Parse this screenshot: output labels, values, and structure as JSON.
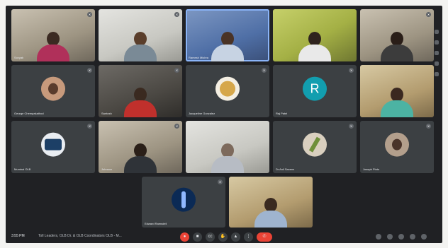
{
  "meeting": {
    "time": "3:55 PM",
    "title": "Toll Leaders, OLB Dr. & OLB Coordinators OLB - M..."
  },
  "participants": [
    {
      "name": "Sovyab",
      "muted": true
    },
    {
      "name": "",
      "muted": true
    },
    {
      "name": "Ramesh Mishra",
      "muted": false
    },
    {
      "name": "",
      "muted": false
    },
    {
      "name": "",
      "muted": true
    },
    {
      "name": "George Chempakathod",
      "muted": true
    },
    {
      "name": "Santosh",
      "muted": true
    },
    {
      "name": "Jacqueline Gonzalez",
      "muted": true
    },
    {
      "name": "Raj Patel",
      "muted": true
    },
    {
      "name": "",
      "muted": false
    },
    {
      "name": "Mumbai OLB",
      "muted": true
    },
    {
      "name": "Johnson",
      "muted": true
    },
    {
      "name": "",
      "muted": false
    },
    {
      "name": "Dr.Anil Saxena",
      "muted": true
    },
    {
      "name": "Joseph Pinto",
      "muted": true
    },
    {
      "name": "Edward Ramsdell",
      "muted": true
    },
    {
      "name": "",
      "muted": false
    }
  ],
  "avatar_letters": {
    "raj": "R"
  },
  "icons": {
    "mic": "mic-off-icon",
    "cam": "camera-icon",
    "cc": "captions-icon",
    "hand": "raise-hand-icon",
    "present": "present-icon",
    "more": "more-options-icon",
    "end": "end-call-icon",
    "info": "info-icon",
    "people": "people-icon",
    "chat": "chat-icon",
    "activities": "activities-icon",
    "lock": "host-controls-icon"
  },
  "labels": {
    "mic": "●",
    "cam": "■",
    "cc": "cc",
    "hand": "✋",
    "present": "▲",
    "more": "⋮",
    "end": "✆",
    "mute": "✕"
  }
}
